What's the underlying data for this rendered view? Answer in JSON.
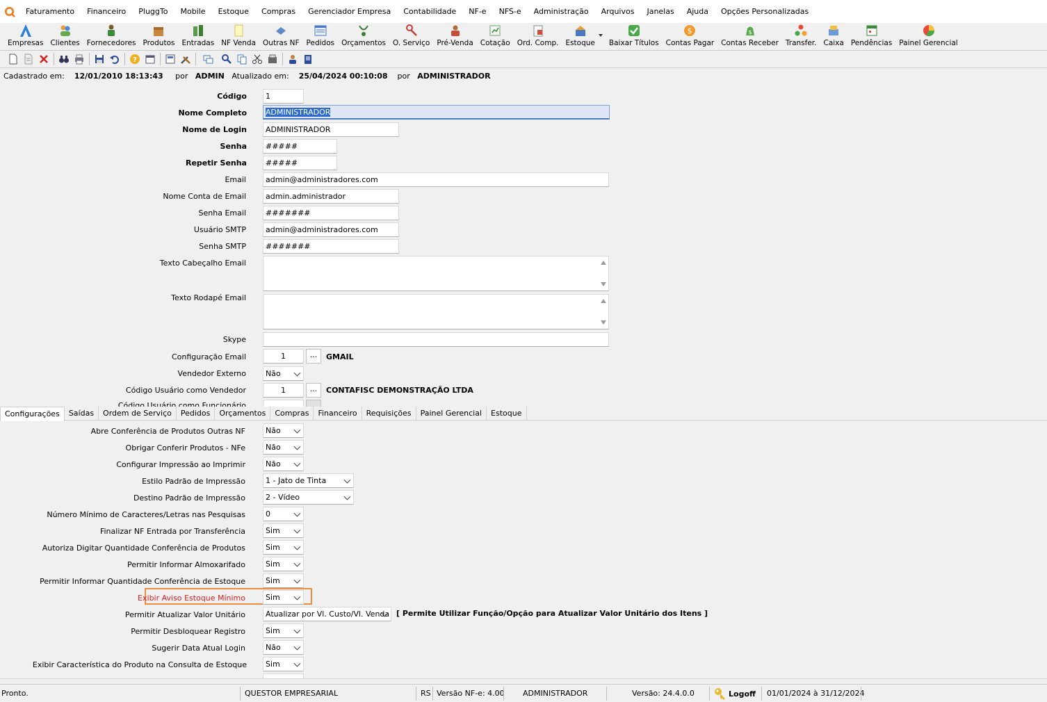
{
  "menu": [
    "Faturamento",
    "Financeiro",
    "PluggTo",
    "Mobile",
    "Estoque",
    "Compras",
    "Gerenciador Empresa",
    "Contabilidade",
    "NF-e",
    "NFS-e",
    "Administração",
    "Arquivos",
    "Janelas",
    "Ajuda",
    "Opções Personalizadas"
  ],
  "toolbar": [
    {
      "label": "Empresas",
      "icon": "empresas-icon"
    },
    {
      "label": "Clientes",
      "icon": "clientes-icon"
    },
    {
      "label": "Fornecedores",
      "icon": "fornecedores-icon"
    },
    {
      "label": "Produtos",
      "icon": "produtos-icon"
    },
    {
      "label": "Entradas",
      "icon": "entradas-icon"
    },
    {
      "label": "NF Venda",
      "icon": "nf-venda-icon"
    },
    {
      "label": "Outras NF",
      "icon": "outras-nf-icon"
    },
    {
      "label": "Pedidos",
      "icon": "pedidos-icon"
    },
    {
      "label": "Orçamentos",
      "icon": "orcamentos-icon"
    },
    {
      "label": "O. Serviço",
      "icon": "ordem-servico-icon"
    },
    {
      "label": "Pré-Venda",
      "icon": "pre-venda-icon"
    },
    {
      "label": "Cotação",
      "icon": "cotacao-icon"
    },
    {
      "label": "Ord. Comp.",
      "icon": "ordem-compra-icon"
    },
    {
      "label": "Estoque",
      "icon": "estoque-icon"
    },
    {
      "label": "Baixar Títulos",
      "icon": "baixar-titulos-icon"
    },
    {
      "label": "Contas Pagar",
      "icon": "contas-pagar-icon"
    },
    {
      "label": "Contas Receber",
      "icon": "contas-receber-icon"
    },
    {
      "label": "Transfer.",
      "icon": "transferencia-icon"
    },
    {
      "label": "Caixa",
      "icon": "caixa-icon"
    },
    {
      "label": "Pendências",
      "icon": "pendencias-icon"
    },
    {
      "label": "Painel Gerencial",
      "icon": "painel-gerencial-icon"
    }
  ],
  "info": {
    "cadastrado_label": "Cadastrado em:",
    "cadastrado_value": "12/01/2010 18:13:43",
    "por1": "por",
    "user1": "ADMIN",
    "atualizado_label": "Atualizado em:",
    "atualizado_value": "25/04/2024 00:10:08",
    "por2": "por",
    "user2": "ADMINISTRADOR"
  },
  "form": {
    "codigo_label": "Código",
    "codigo": "1",
    "nome_label": "Nome Completo",
    "nome": "ADMINISTRADOR",
    "login_label": "Nome de Login",
    "login": "ADMINISTRADOR",
    "senha_label": "Senha",
    "senha": "#####",
    "repetir_label": "Repetir Senha",
    "repetir": "#####",
    "email_label": "Email",
    "email": "admin@administradores.com",
    "conta_email_label": "Nome Conta de Email",
    "conta_email": "admin.administrador",
    "senha_email_label": "Senha Email",
    "senha_email": "#######",
    "usuario_smtp_label": "Usuário SMTP",
    "usuario_smtp": "admin@administradores.com",
    "senha_smtp_label": "Senha SMTP",
    "senha_smtp": "#######",
    "cabecalho_label": "Texto Cabeçalho Email",
    "rodape_label": "Texto Rodapé Email",
    "skype_label": "Skype",
    "config_email_label": "Configuração Email",
    "config_email": "1",
    "config_email_desc": "GMAIL",
    "vendedor_externo_label": "Vendedor Externo",
    "vendedor_externo": "Não",
    "cod_vendedor_label": "Código Usuário como Vendedor",
    "cod_vendedor": "1",
    "cod_vendedor_desc": "CONTAFISC DEMONSTRAÇÃO LTDA",
    "cod_funcionario_label": "Código Usuário como Funcionário",
    "dots": "..."
  },
  "tabs": [
    "Configurações",
    "Saídas",
    "Ordem de Serviço",
    "Pedidos",
    "Orçamentos",
    "Compras",
    "Financeiro",
    "Requisições",
    "Painel Gerencial",
    "Estoque"
  ],
  "config": [
    {
      "label": "Abre Conferência de Produtos Outras NF",
      "value": "Não"
    },
    {
      "label": "Obrigar Conferir Produtos - NFe",
      "value": "Não"
    },
    {
      "label": "Configurar Impressão ao Imprimir",
      "value": "Não"
    },
    {
      "label": "Estilo Padrão de Impressão",
      "value": "1 - Jato de Tinta"
    },
    {
      "label": "Destino Padrão de Impressão",
      "value": "2 - Vídeo"
    },
    {
      "label": "Número Mínimo de Caracteres/Letras nas Pesquisas",
      "value": "0"
    },
    {
      "label": "Finalizar NF Entrada por Transferência",
      "value": "Sim"
    },
    {
      "label": "Autoriza Digitar Quantidade Conferência de Produtos",
      "value": "Sim"
    },
    {
      "label": "Permitir Informar Almoxarifado",
      "value": "Sim"
    },
    {
      "label": "Permitir Informar Quantidade Conferência de Estoque",
      "value": "Sim"
    },
    {
      "label": "Exibir Aviso Estoque Mínimo",
      "value": "Sim"
    },
    {
      "label": "Permitir Atualizar Valor Unitário",
      "value": "Atualizar por Vl. Custo/Vl. Venda"
    },
    {
      "label": "Permitir Desbloquear Registro",
      "value": "Sim"
    },
    {
      "label": "Sugerir Data Atual Login",
      "value": "Não"
    },
    {
      "label": "Exibir Característica do Produto na Consulta de Estoque",
      "value": "Sim"
    }
  ],
  "valor_unitario_note": "[ Permite Utilizar Função/Opção para Atualizar Valor Unitário dos Itens ]",
  "status": {
    "pronto": "Pronto.",
    "sistema": "QUESTOR EMPRESARIAL",
    "uf": "RS",
    "versao_nfe": "Versão NF-e: 4.00",
    "usuario": "ADMINISTRADOR",
    "versao": "Versão: 24.4.0.0",
    "logoff": "Logoff",
    "periodo": "01/01/2024 à 31/12/2024"
  },
  "colors": {
    "highlight": "#f08a3c",
    "highlight_text": "#d42020",
    "selection": "#2d6bd0"
  }
}
